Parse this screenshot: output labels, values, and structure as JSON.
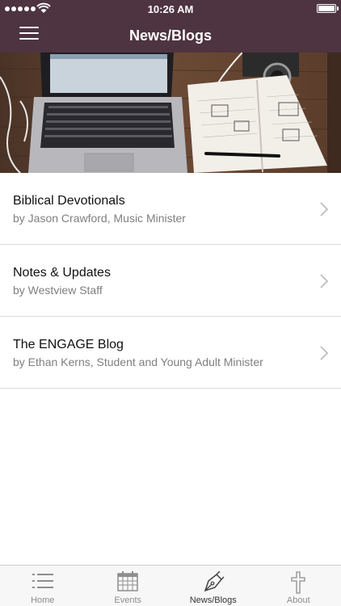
{
  "status_bar": {
    "time": "10:26 AM"
  },
  "header": {
    "title": "News/Blogs",
    "menu_icon": "hamburger-icon"
  },
  "hero": {
    "image": "laptop-notebook-desk-photo"
  },
  "blogs": [
    {
      "title": "Biblical Devotionals",
      "subtitle": "by Jason Crawford, Music Minister"
    },
    {
      "title": "Notes & Updates",
      "subtitle": "by Westview Staff"
    },
    {
      "title": "The ENGAGE Blog",
      "subtitle": "by Ethan Kerns, Student and Young Adult Minister"
    }
  ],
  "tabs": [
    {
      "label": "Home",
      "icon": "list-icon"
    },
    {
      "label": "Events",
      "icon": "calendar-icon"
    },
    {
      "label": "News/Blogs",
      "icon": "pen-icon",
      "active": true
    },
    {
      "label": "About",
      "icon": "cross-icon"
    }
  ],
  "colors": {
    "header": "#4e3440",
    "subtitle": "#7f7f7f",
    "separator": "#dcdcdc"
  }
}
